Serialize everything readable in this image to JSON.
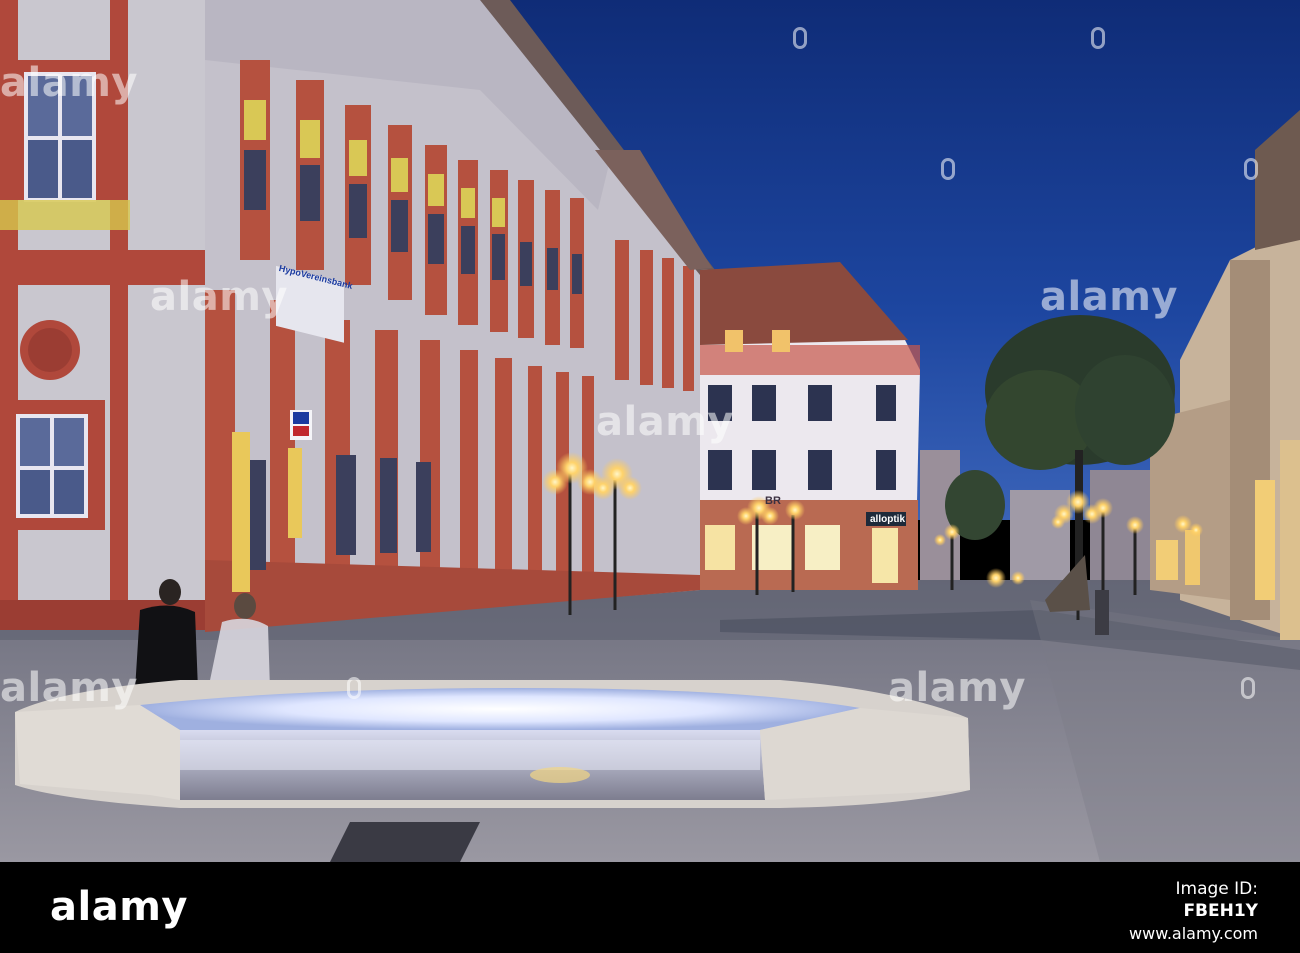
{
  "photo": {
    "description_alt": "",
    "shop_signs": {
      "bank_sign": "HypoVereinsbank",
      "optician_sign": "alloptik",
      "shop_sign_partial": "BR"
    }
  },
  "watermark": {
    "text": "alamy"
  },
  "footer": {
    "logo": "alamy",
    "image_id_label": "Image ID:",
    "image_id": "FBEH1Y",
    "url": "www.alamy.com"
  },
  "colors": {
    "sky": "#1b3f8f",
    "facade_red": "#b5513f",
    "facade_white": "#c9c7cf",
    "lamp_glow": "#ffd36b",
    "fountain_light": "#f2f4ff",
    "pavement": "#8a8a96"
  }
}
